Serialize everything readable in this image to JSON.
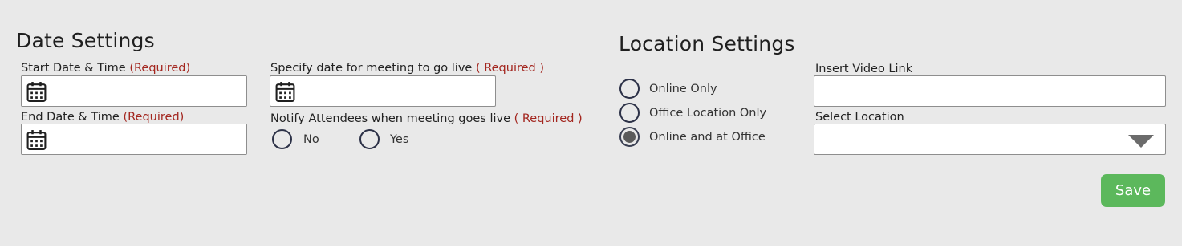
{
  "date_settings": {
    "title": "Date Settings",
    "start": {
      "label": "Start Date & Time",
      "required": "(Required)",
      "value": ""
    },
    "end": {
      "label": "End Date & Time",
      "required": "(Required)",
      "value": ""
    },
    "go_live": {
      "label": "Specify date for meeting to go live",
      "required": "( Required )",
      "value": ""
    },
    "notify": {
      "label": "Notify Attendees when meeting goes live",
      "required": "( Required )",
      "options": [
        "No",
        "Yes"
      ],
      "selected": null
    }
  },
  "location_settings": {
    "title": "Location Settings",
    "options": [
      "Online Only",
      "Office Location Only",
      "Online and at Office"
    ],
    "selected": "Online and at Office",
    "video_link": {
      "label": "Insert Video Link",
      "value": ""
    },
    "select_location": {
      "label": "Select Location",
      "value": ""
    }
  },
  "actions": {
    "save_label": "Save"
  },
  "colors": {
    "background": "#e9e9e9",
    "required": "#a3261f",
    "save": "#5cb85c",
    "radio_border": "#2c3147"
  },
  "icons": {
    "date_picker": "calendar-icon",
    "dropdown": "chevron-down-icon"
  }
}
